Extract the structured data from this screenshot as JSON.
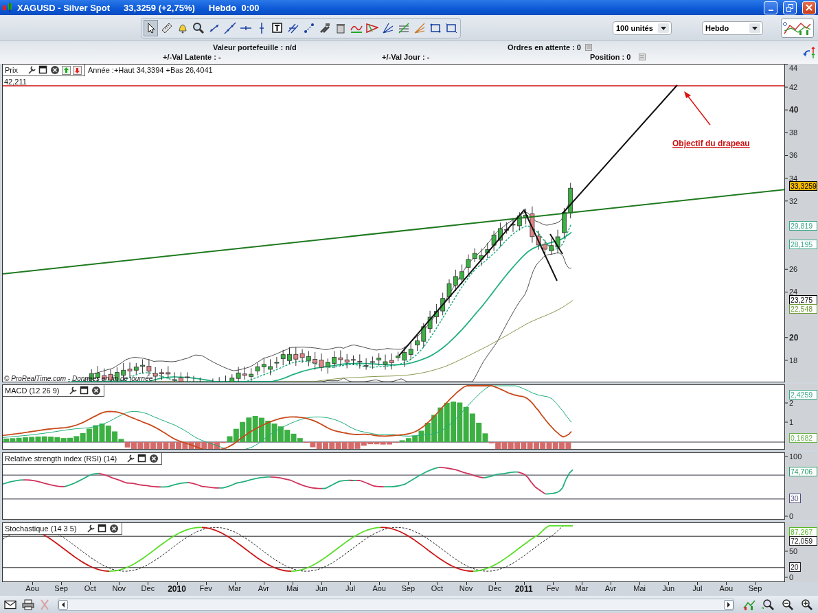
{
  "window": {
    "title": "XAGUSD - Silver Spot",
    "quote": "33,3259 (+2,75%)",
    "period": "Hebdo  0:00"
  },
  "toolbar": {
    "quantity": "100 unités",
    "timeframe": "Hebdo"
  },
  "account": {
    "portfolio_value": "Valeur portefeuille : n/d",
    "pending_orders": "Ordres en attente : 0",
    "latent_value": "+/-Val Latente : -",
    "day_value": "+/-Val Jour : -",
    "position": "Position : 0"
  },
  "price_panel": {
    "title": "Prix",
    "year_range": "Année :+Haut 34,3394 +Bas 26,4041",
    "target_label": "42,211",
    "annotation": "Objectif du drapeau",
    "copyright": "© ProRealTime.com - Données en fin de journée",
    "axis_ticks": [
      "44",
      "42",
      "40",
      "38",
      "36",
      "34",
      "32",
      "26",
      "24",
      "20",
      "18"
    ],
    "value_tags": [
      {
        "text": "33,3259",
        "color": "#000000",
        "highlighted": true
      },
      {
        "text": "29,819",
        "color": "#3aa88a",
        "highlighted": false
      },
      {
        "text": "28,195",
        "color": "#3aa88a",
        "highlighted": false
      },
      {
        "text": "23,275",
        "color": "#000000",
        "highlighted": false
      },
      {
        "text": "22,548",
        "color": "#6f9a3a",
        "highlighted": false
      }
    ]
  },
  "indicators": [
    {
      "kind": "macd",
      "title": "MACD (12 26 9)",
      "axis_ticks": [
        "2",
        "1"
      ],
      "value_tags": [
        {
          "text": "2,4259",
          "color": "#3aa88a"
        },
        {
          "text": "0,1682",
          "color": "#6ab04c"
        }
      ]
    },
    {
      "kind": "rsi",
      "title": "Relative strength index (RSI) (14)",
      "axis_ticks": [
        "100",
        "0"
      ],
      "value_tags": [
        {
          "text": "74,706",
          "color": "#2e9e6e"
        },
        {
          "text": "30",
          "color": "#505080"
        }
      ]
    },
    {
      "kind": "stochastic",
      "title": "Stochastique (14 3 5)",
      "axis_ticks": [
        "50",
        "0"
      ],
      "value_tags": [
        {
          "text": "87,267",
          "color": "#55bb22"
        },
        {
          "text": "72,059",
          "color": "#222222"
        },
        {
          "text": "20",
          "color": "#222222"
        }
      ]
    }
  ],
  "x_axis": [
    {
      "label": "Aou",
      "kind": "month"
    },
    {
      "label": "Sep",
      "kind": "month"
    },
    {
      "label": "Oct",
      "kind": "month"
    },
    {
      "label": "Nov",
      "kind": "month"
    },
    {
      "label": "Dec",
      "kind": "month"
    },
    {
      "label": "2010",
      "kind": "year"
    },
    {
      "label": "Fev",
      "kind": "month"
    },
    {
      "label": "Mar",
      "kind": "month"
    },
    {
      "label": "Avr",
      "kind": "month"
    },
    {
      "label": "Mai",
      "kind": "month"
    },
    {
      "label": "Jun",
      "kind": "month"
    },
    {
      "label": "Jul",
      "kind": "month"
    },
    {
      "label": "Aou",
      "kind": "month"
    },
    {
      "label": "Sep",
      "kind": "month"
    },
    {
      "label": "Oct",
      "kind": "month"
    },
    {
      "label": "Nov",
      "kind": "month"
    },
    {
      "label": "Dec",
      "kind": "month"
    },
    {
      "label": "2011",
      "kind": "year"
    },
    {
      "label": "Fev",
      "kind": "month"
    },
    {
      "label": "Mar",
      "kind": "month"
    },
    {
      "label": "Avr",
      "kind": "month"
    },
    {
      "label": "Mai",
      "kind": "month"
    },
    {
      "label": "Jun",
      "kind": "month"
    },
    {
      "label": "Jul",
      "kind": "month"
    },
    {
      "label": "Aou",
      "kind": "month"
    },
    {
      "label": "Sep",
      "kind": "month"
    }
  ]
}
